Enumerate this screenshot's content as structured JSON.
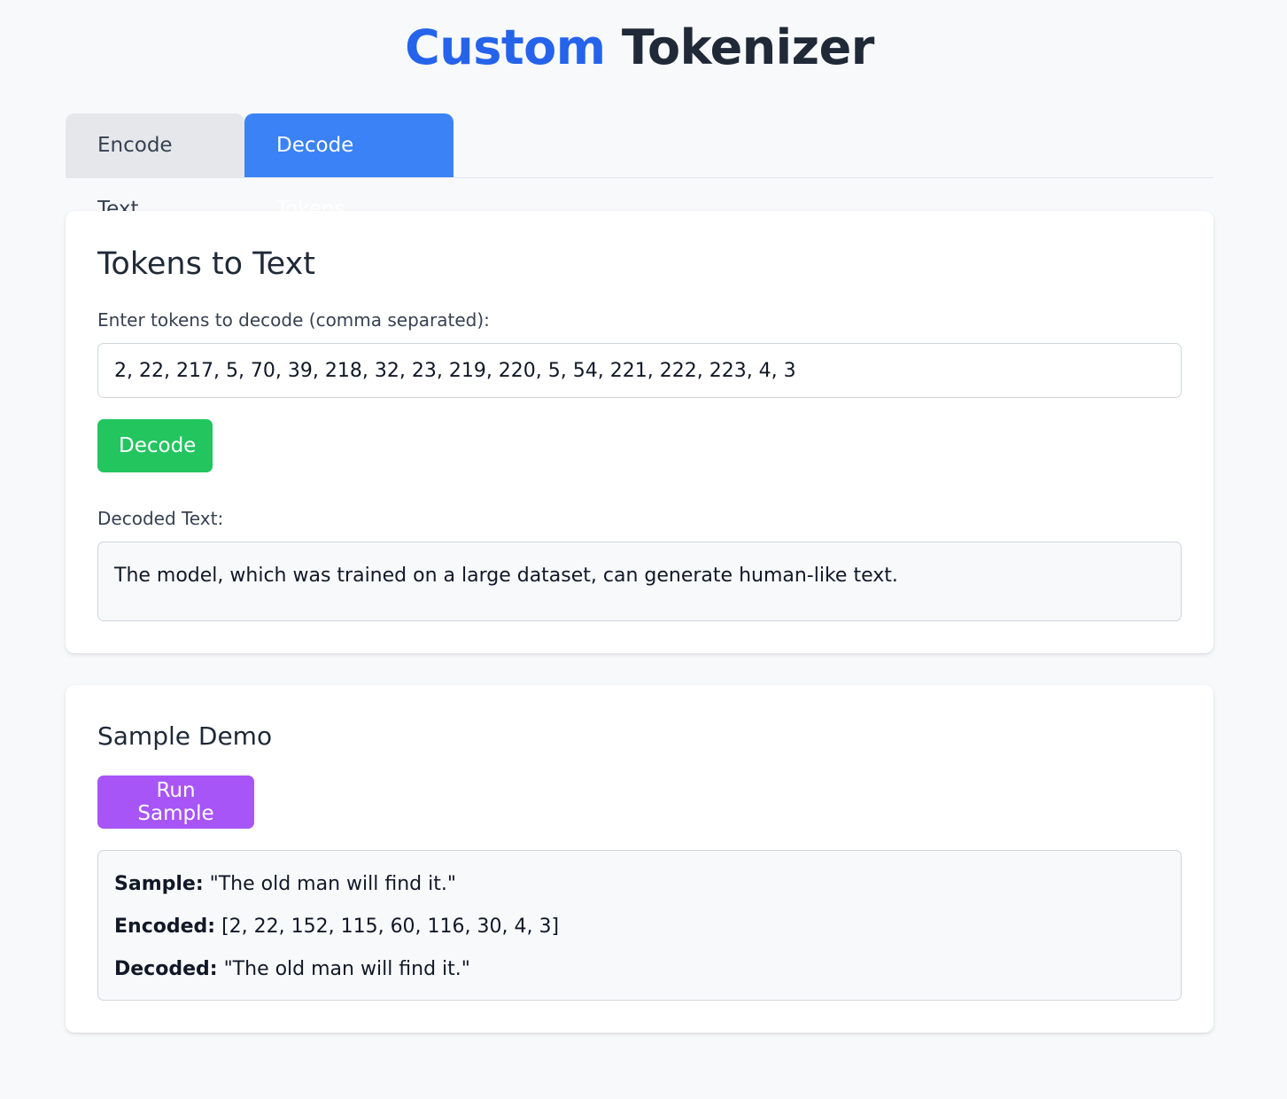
{
  "header": {
    "title_accent": "Custom",
    "title_rest": "Tokenizer"
  },
  "tabs": [
    {
      "label": "Encode Text",
      "active": false
    },
    {
      "label": "Decode Tokens",
      "active": true
    }
  ],
  "decode_card": {
    "title": "Tokens to Text",
    "input_label": "Enter tokens to decode (comma separated):",
    "input_value": "2, 22, 217, 5, 70, 39, 218, 32, 23, 219, 220, 5, 54, 221, 222, 223, 4, 3",
    "button_label": "Decode",
    "output_label": "Decoded Text:",
    "output_value": "The model, which was trained on a large dataset, can generate human-like text."
  },
  "sample_card": {
    "title": "Sample Demo",
    "button_label": "Run Sample",
    "sample_label": "Sample:",
    "sample_value": "\"The old man will find it.\"",
    "encoded_label": "Encoded:",
    "encoded_value": "[2, 22, 152, 115, 60, 116, 30, 4, 3]",
    "decoded_label": "Decoded:",
    "decoded_value": "\"The old man will find it.\""
  },
  "colors": {
    "accent": "#2563eb",
    "tab_active": "#3b82f6",
    "decode_button": "#22c55e",
    "sample_button": "#a855f7"
  }
}
